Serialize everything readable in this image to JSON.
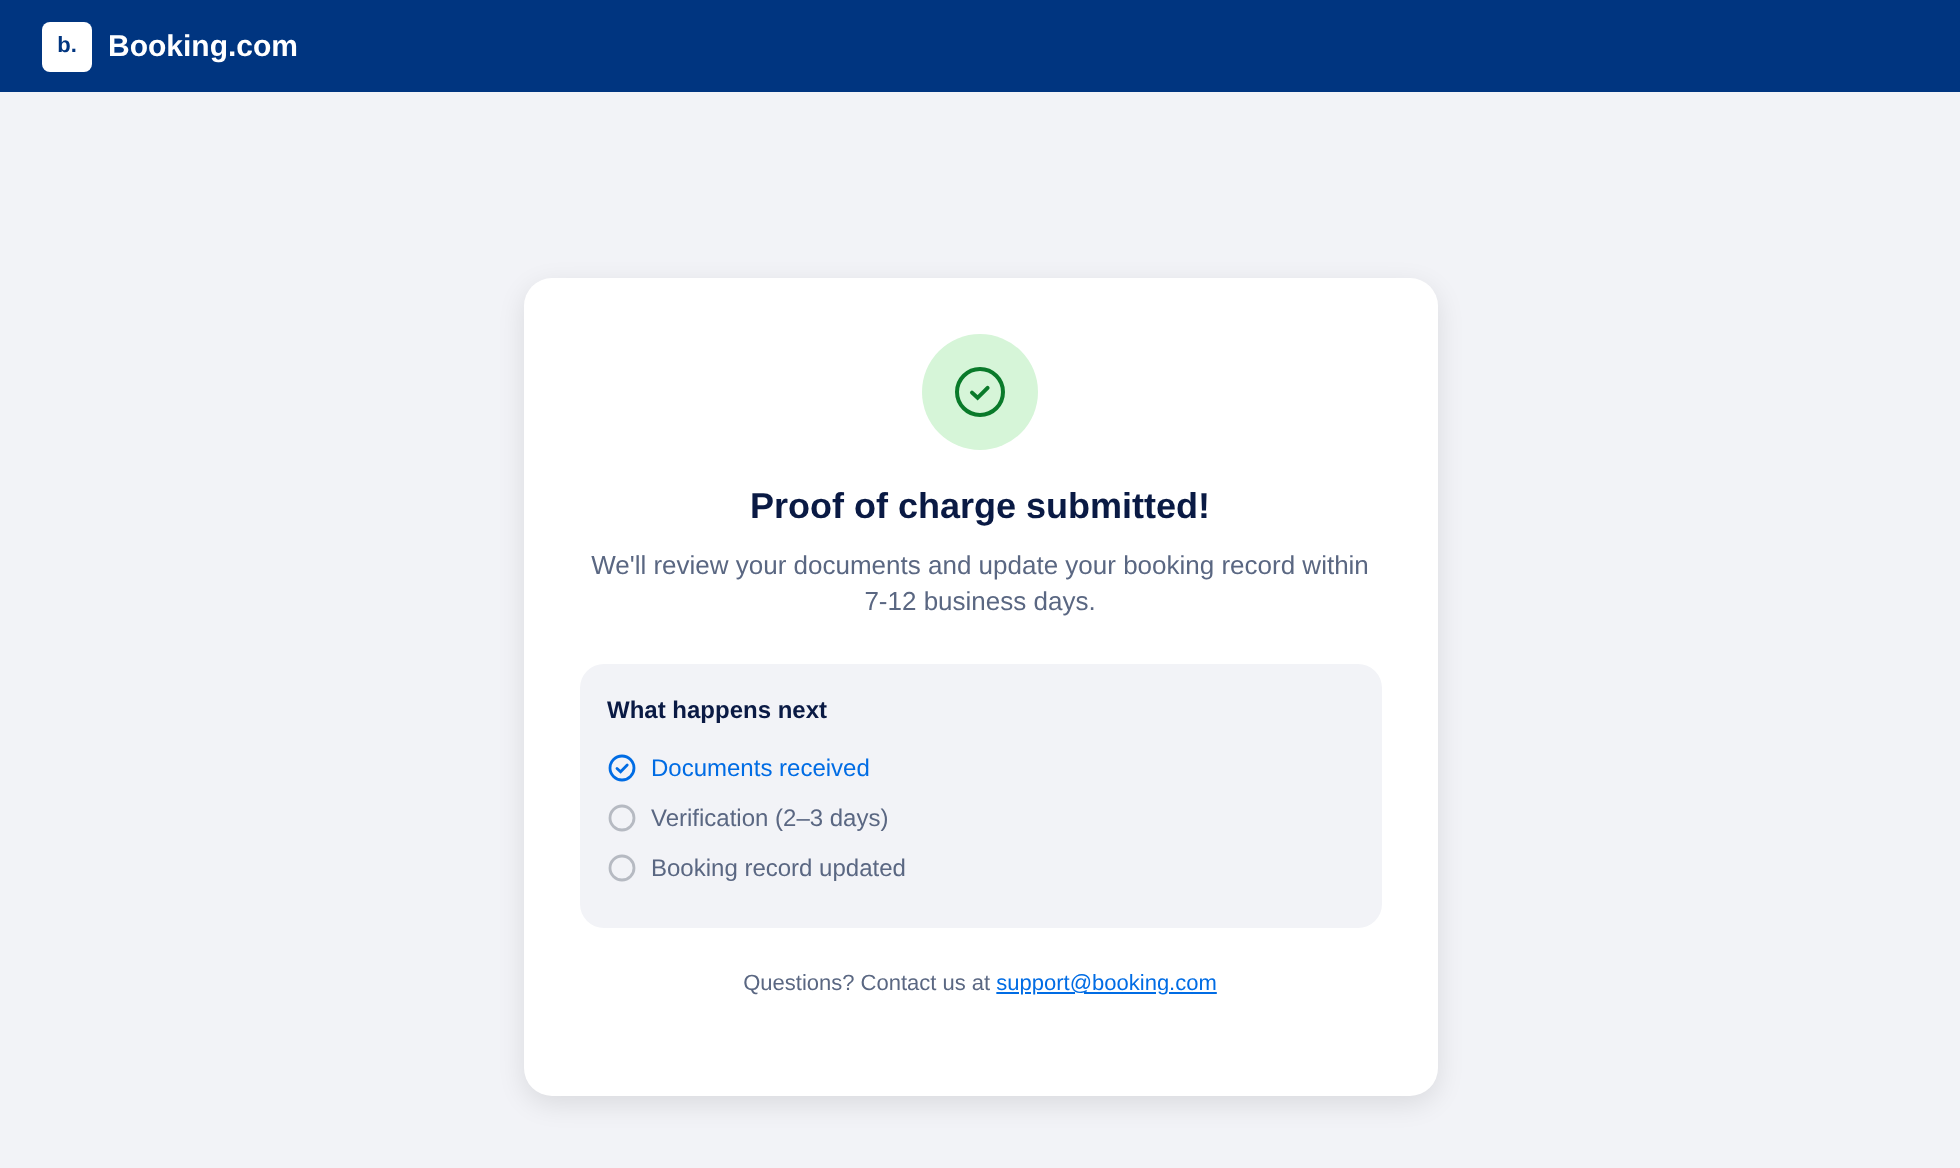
{
  "header": {
    "logo_mark": "b.",
    "brand": "Booking.com"
  },
  "card": {
    "title": "Proof of charge submitted!",
    "message": "We'll review your documents and update your booking record within 7-12 business days.",
    "next_steps": {
      "heading": "What happens next",
      "steps": [
        {
          "label": "Documents received",
          "done": true
        },
        {
          "label": "Verification (2–3 days)",
          "done": false
        },
        {
          "label": "Booking record updated",
          "done": false
        }
      ]
    },
    "contact": {
      "text": "Questions? Contact us at",
      "link": "support@booking.com"
    }
  }
}
